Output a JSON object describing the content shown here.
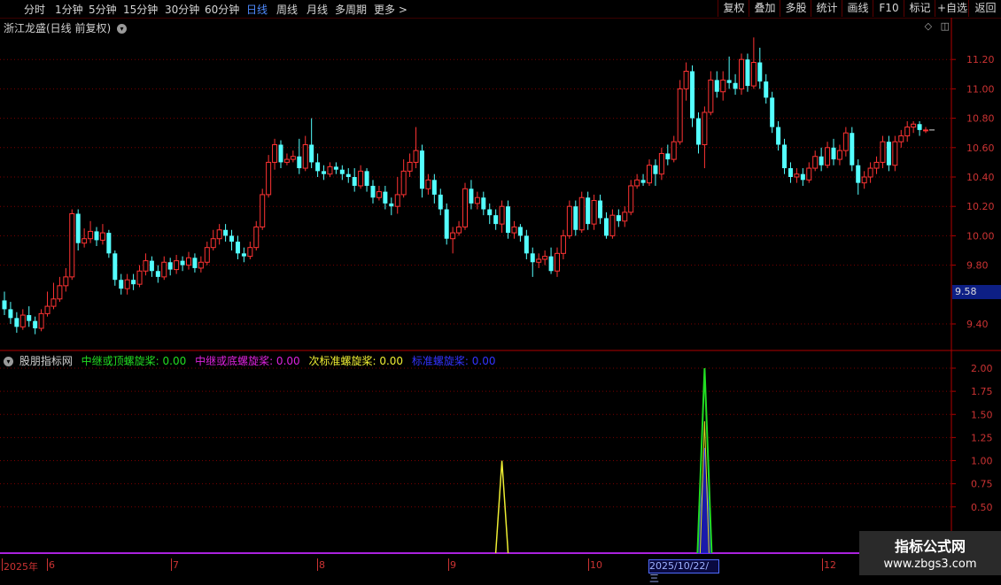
{
  "toolbar": {
    "left_items": [
      "分时",
      "1分钟",
      "5分钟",
      "15分钟",
      "30分钟",
      "60分钟",
      "日线",
      "周线",
      "月线",
      "多周期",
      "更多 >"
    ],
    "active_item": "日线",
    "right_items": [
      "复权",
      "叠加",
      "多股",
      "统计",
      "画线",
      "F10",
      "标记",
      "+自选",
      "返回"
    ]
  },
  "stock": {
    "title": "浙江龙盛(日线 前复权)",
    "current_price_tag": "9.58"
  },
  "price_axis": {
    "ticks": [
      "11.20",
      "11.00",
      "10.80",
      "10.60",
      "10.40",
      "10.20",
      "10.00",
      "9.80",
      "9.40"
    ]
  },
  "indicator": {
    "name": "股朋指标网",
    "series": [
      {
        "label": "中继或顶螺旋桨: 0.00",
        "color": "#22dd22"
      },
      {
        "label": "中继或底螺旋桨: 0.00",
        "color": "#dd22dd"
      },
      {
        "label": "次标准螺旋桨: 0.00",
        "color": "#eeee33"
      },
      {
        "label": "标准螺旋桨: 0.00",
        "color": "#2222ee"
      }
    ],
    "axis_ticks": [
      "2.00",
      "1.75",
      "1.50",
      "1.25",
      "1.00",
      "0.75",
      "0.50"
    ]
  },
  "date_axis": {
    "labels": [
      "2025年",
      "6",
      "7",
      "8",
      "9",
      "10",
      "12"
    ],
    "highlight": "2025/10/22/三"
  },
  "watermark": {
    "line1": "指标公式网",
    "line2": "www.zbgs3.com"
  },
  "colors": {
    "up": "#ff3333",
    "down": "#54ffff",
    "grid": "#7a0000",
    "axis": "#b00000"
  },
  "chart_data": [
    {
      "type": "candlestick",
      "title": "浙江龙盛(日线 前复权)",
      "ylim": [
        9.3,
        11.35
      ],
      "candles": [
        [
          9.56,
          9.5,
          9.62,
          9.46
        ],
        [
          9.5,
          9.44,
          9.55,
          9.4
        ],
        [
          9.44,
          9.38,
          9.48,
          9.34
        ],
        [
          9.38,
          9.46,
          9.5,
          9.36
        ],
        [
          9.46,
          9.42,
          9.52,
          9.38
        ],
        [
          9.42,
          9.37,
          9.45,
          9.33
        ],
        [
          9.37,
          9.47,
          9.5,
          9.35
        ],
        [
          9.47,
          9.52,
          9.62,
          9.45
        ],
        [
          9.52,
          9.57,
          9.68,
          9.5
        ],
        [
          9.57,
          9.66,
          9.72,
          9.55
        ],
        [
          9.66,
          9.72,
          9.78,
          9.62
        ],
        [
          9.72,
          10.15,
          10.18,
          9.7
        ],
        [
          10.15,
          9.95,
          10.18,
          9.9
        ],
        [
          9.95,
          9.98,
          10.05,
          9.92
        ],
        [
          9.98,
          10.03,
          10.1,
          9.95
        ],
        [
          10.03,
          9.97,
          10.06,
          9.93
        ],
        [
          9.97,
          10.02,
          10.08,
          9.94
        ],
        [
          10.02,
          9.88,
          10.04,
          9.85
        ],
        [
          9.88,
          9.7,
          9.9,
          9.66
        ],
        [
          9.7,
          9.64,
          9.74,
          9.6
        ],
        [
          9.64,
          9.7,
          9.74,
          9.6
        ],
        [
          9.7,
          9.67,
          9.74,
          9.63
        ],
        [
          9.67,
          9.76,
          9.8,
          9.65
        ],
        [
          9.76,
          9.83,
          9.88,
          9.73
        ],
        [
          9.83,
          9.76,
          9.86,
          9.72
        ],
        [
          9.76,
          9.72,
          9.8,
          9.68
        ],
        [
          9.72,
          9.82,
          9.86,
          9.7
        ],
        [
          9.82,
          9.77,
          9.85,
          9.73
        ],
        [
          9.77,
          9.83,
          9.87,
          9.74
        ],
        [
          9.83,
          9.8,
          9.86,
          9.76
        ],
        [
          9.8,
          9.85,
          9.89,
          9.77
        ],
        [
          9.85,
          9.78,
          9.88,
          9.75
        ],
        [
          9.78,
          9.82,
          9.86,
          9.75
        ],
        [
          9.82,
          9.92,
          9.96,
          9.8
        ],
        [
          9.92,
          9.98,
          10.04,
          9.9
        ],
        [
          9.98,
          10.04,
          10.08,
          9.94
        ],
        [
          10.04,
          10.0,
          10.08,
          9.96
        ],
        [
          10.0,
          9.96,
          10.04,
          9.9
        ],
        [
          9.96,
          9.88,
          10.0,
          9.84
        ],
        [
          9.88,
          9.86,
          9.92,
          9.82
        ],
        [
          9.86,
          9.92,
          9.96,
          9.84
        ],
        [
          9.92,
          10.06,
          10.1,
          9.9
        ],
        [
          10.06,
          10.28,
          10.32,
          10.04
        ],
        [
          10.28,
          10.5,
          10.55,
          10.26
        ],
        [
          10.5,
          10.62,
          10.66,
          10.45
        ],
        [
          10.62,
          10.5,
          10.65,
          10.46
        ],
        [
          10.5,
          10.52,
          10.56,
          10.48
        ],
        [
          10.52,
          10.54,
          10.58,
          10.5
        ],
        [
          10.54,
          10.46,
          10.66,
          10.42
        ],
        [
          10.46,
          10.62,
          10.68,
          10.44
        ],
        [
          10.62,
          10.5,
          10.8,
          10.46
        ],
        [
          10.5,
          10.44,
          10.56,
          10.4
        ],
        [
          10.44,
          10.42,
          10.48,
          10.38
        ],
        [
          10.42,
          10.47,
          10.5,
          10.4
        ],
        [
          10.47,
          10.45,
          10.5,
          10.42
        ],
        [
          10.45,
          10.42,
          10.48,
          10.38
        ],
        [
          10.42,
          10.4,
          10.46,
          10.36
        ],
        [
          10.4,
          10.34,
          10.46,
          10.3
        ],
        [
          10.34,
          10.44,
          10.48,
          10.32
        ],
        [
          10.44,
          10.34,
          10.46,
          10.3
        ],
        [
          10.34,
          10.26,
          10.38,
          10.22
        ],
        [
          10.26,
          10.3,
          10.34,
          10.24
        ],
        [
          10.3,
          10.22,
          10.34,
          10.18
        ],
        [
          10.22,
          10.2,
          10.26,
          10.14
        ],
        [
          10.2,
          10.28,
          10.4,
          10.15
        ],
        [
          10.28,
          10.44,
          10.52,
          10.26
        ],
        [
          10.44,
          10.5,
          10.56,
          10.4
        ],
        [
          10.5,
          10.58,
          10.74,
          10.46
        ],
        [
          10.58,
          10.32,
          10.62,
          10.26
        ],
        [
          10.32,
          10.38,
          10.42,
          10.28
        ],
        [
          10.38,
          10.28,
          10.42,
          10.22
        ],
        [
          10.28,
          10.18,
          10.32,
          10.14
        ],
        [
          10.18,
          9.98,
          10.22,
          9.94
        ],
        [
          9.98,
          10.02,
          10.06,
          9.88
        ],
        [
          10.02,
          10.06,
          10.1,
          10.0
        ],
        [
          10.06,
          10.32,
          10.36,
          10.04
        ],
        [
          10.32,
          10.22,
          10.38,
          10.18
        ],
        [
          10.22,
          10.26,
          10.3,
          10.18
        ],
        [
          10.26,
          10.18,
          10.3,
          10.14
        ],
        [
          10.18,
          10.14,
          10.22,
          10.08
        ],
        [
          10.14,
          10.08,
          10.18,
          10.04
        ],
        [
          10.08,
          10.2,
          10.24,
          10.02
        ],
        [
          10.2,
          10.02,
          10.24,
          9.98
        ],
        [
          10.02,
          10.06,
          10.1,
          9.98
        ],
        [
          10.06,
          10.0,
          10.08,
          9.96
        ],
        [
          10.0,
          9.88,
          10.04,
          9.84
        ],
        [
          9.88,
          9.82,
          9.92,
          9.72
        ],
        [
          9.82,
          9.84,
          9.88,
          9.78
        ],
        [
          9.84,
          9.86,
          9.9,
          9.8
        ],
        [
          9.86,
          9.76,
          9.92,
          9.74
        ],
        [
          9.76,
          9.88,
          9.92,
          9.72
        ],
        [
          9.88,
          10.0,
          10.04,
          9.84
        ],
        [
          10.0,
          10.2,
          10.24,
          9.98
        ],
        [
          10.2,
          10.04,
          10.24,
          10.0
        ],
        [
          10.04,
          10.26,
          10.3,
          10.02
        ],
        [
          10.26,
          10.08,
          10.3,
          10.04
        ],
        [
          10.08,
          10.24,
          10.28,
          10.04
        ],
        [
          10.24,
          10.12,
          10.28,
          10.08
        ],
        [
          10.12,
          10.0,
          10.16,
          9.98
        ],
        [
          10.0,
          10.14,
          10.18,
          9.98
        ],
        [
          10.14,
          10.1,
          10.18,
          10.06
        ],
        [
          10.1,
          10.16,
          10.2,
          10.06
        ],
        [
          10.16,
          10.34,
          10.38,
          10.14
        ],
        [
          10.34,
          10.38,
          10.42,
          10.32
        ],
        [
          10.38,
          10.36,
          10.42,
          10.34
        ],
        [
          10.36,
          10.48,
          10.52,
          10.34
        ],
        [
          10.48,
          10.42,
          10.52,
          10.34
        ],
        [
          10.42,
          10.56,
          10.6,
          10.38
        ],
        [
          10.56,
          10.52,
          10.62,
          10.48
        ],
        [
          10.52,
          10.64,
          10.68,
          10.5
        ],
        [
          10.64,
          11.0,
          11.06,
          10.62
        ],
        [
          11.0,
          11.12,
          11.18,
          10.92
        ],
        [
          11.12,
          10.8,
          11.16,
          10.74
        ],
        [
          10.8,
          10.62,
          10.84,
          10.56
        ],
        [
          10.62,
          10.84,
          10.88,
          10.46
        ],
        [
          10.84,
          11.06,
          11.12,
          10.82
        ],
        [
          11.06,
          10.98,
          11.12,
          10.94
        ],
        [
          10.98,
          11.06,
          11.12,
          10.92
        ],
        [
          11.06,
          11.04,
          11.22,
          11.0
        ],
        [
          11.04,
          11.0,
          11.1,
          10.96
        ],
        [
          11.0,
          11.2,
          11.24,
          10.96
        ],
        [
          11.2,
          11.02,
          11.24,
          10.98
        ],
        [
          11.02,
          11.18,
          11.35,
          11.0
        ],
        [
          11.18,
          11.05,
          11.28,
          11.0
        ],
        [
          11.05,
          10.94,
          11.1,
          10.9
        ],
        [
          10.94,
          10.74,
          10.98,
          10.7
        ],
        [
          10.74,
          10.62,
          10.78,
          10.58
        ],
        [
          10.62,
          10.46,
          10.66,
          10.42
        ],
        [
          10.46,
          10.4,
          10.5,
          10.36
        ],
        [
          10.4,
          10.42,
          10.46,
          10.36
        ],
        [
          10.42,
          10.38,
          10.46,
          10.34
        ],
        [
          10.38,
          10.46,
          10.5,
          10.36
        ],
        [
          10.46,
          10.54,
          10.58,
          10.44
        ],
        [
          10.54,
          10.48,
          10.6,
          10.44
        ],
        [
          10.48,
          10.6,
          10.64,
          10.46
        ],
        [
          10.6,
          10.52,
          10.66,
          10.48
        ],
        [
          10.52,
          10.58,
          10.62,
          10.48
        ],
        [
          10.58,
          10.7,
          10.74,
          10.54
        ],
        [
          10.7,
          10.48,
          10.74,
          10.44
        ],
        [
          10.48,
          10.36,
          10.52,
          10.28
        ],
        [
          10.36,
          10.4,
          10.44,
          10.32
        ],
        [
          10.4,
          10.46,
          10.5,
          10.36
        ],
        [
          10.46,
          10.5,
          10.54,
          10.42
        ],
        [
          10.5,
          10.64,
          10.68,
          10.46
        ],
        [
          10.64,
          10.48,
          10.68,
          10.44
        ],
        [
          10.48,
          10.64,
          10.68,
          10.44
        ],
        [
          10.64,
          10.68,
          10.72,
          10.6
        ],
        [
          10.68,
          10.74,
          10.78,
          10.64
        ],
        [
          10.74,
          10.76,
          10.78,
          10.7
        ],
        [
          10.76,
          10.72,
          10.78,
          10.68
        ],
        [
          10.72,
          10.72,
          10.74,
          10.7
        ]
      ]
    },
    {
      "type": "line",
      "title": "股朋指标网",
      "ylim": [
        0,
        2.0
      ],
      "spikes": [
        {
          "series": "次标准螺旋桨",
          "candle_index": 81,
          "value": 1.0
        },
        {
          "series": "中继或顶螺旋桨",
          "candle_index": 114,
          "value": 2.0
        }
      ]
    }
  ]
}
